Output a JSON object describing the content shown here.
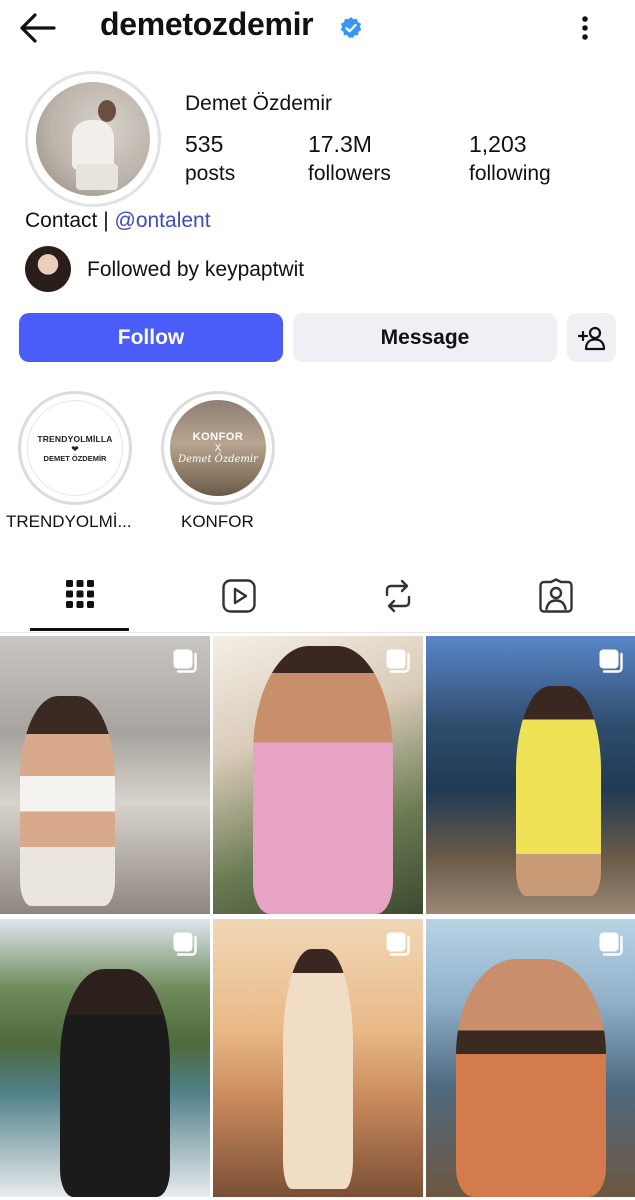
{
  "header": {
    "username": "demetozdemir",
    "verified": true
  },
  "profile": {
    "display_name": "Demet Özdemir",
    "stats": {
      "posts_count": "535",
      "posts_label": "posts",
      "followers_count": "17.3M",
      "followers_label": "followers",
      "following_count": "1,203",
      "following_label": "following"
    },
    "bio_prefix": "Contact | ",
    "bio_handle": "@ontalent",
    "followed_by": "Followed by keypaptwit"
  },
  "actions": {
    "follow_label": "Follow",
    "message_label": "Message",
    "add_person_icon": "person-add-icon"
  },
  "highlights": [
    {
      "label": "TRENDYOLMİ...",
      "cover_line1": "TRENDYOLMİLLA",
      "cover_heart": "❤",
      "cover_line2": "DEMET ÖZDEMİR"
    },
    {
      "label": "KONFOR",
      "cover_line1": "KONFOR",
      "cover_line2": "X",
      "cover_line3": "Demet Özdemir"
    }
  ],
  "tabs": [
    {
      "name": "grid",
      "icon": "grid-icon",
      "active": true
    },
    {
      "name": "reels",
      "icon": "reels-play-icon",
      "active": false
    },
    {
      "name": "reposts",
      "icon": "repost-icon",
      "active": false
    },
    {
      "name": "tagged",
      "icon": "tagged-person-icon",
      "active": false
    }
  ],
  "posts": [
    {
      "type": "carousel",
      "icon": "carousel-icon"
    },
    {
      "type": "carousel",
      "icon": "carousel-icon"
    },
    {
      "type": "carousel",
      "icon": "carousel-icon"
    },
    {
      "type": "carousel",
      "icon": "carousel-icon"
    },
    {
      "type": "carousel",
      "icon": "carousel-icon"
    },
    {
      "type": "carousel",
      "icon": "carousel-icon"
    }
  ],
  "colors": {
    "accent": "#4a5df9",
    "verified": "#3897f0",
    "link": "#3d4bbd",
    "button_secondary": "#efeff4"
  }
}
